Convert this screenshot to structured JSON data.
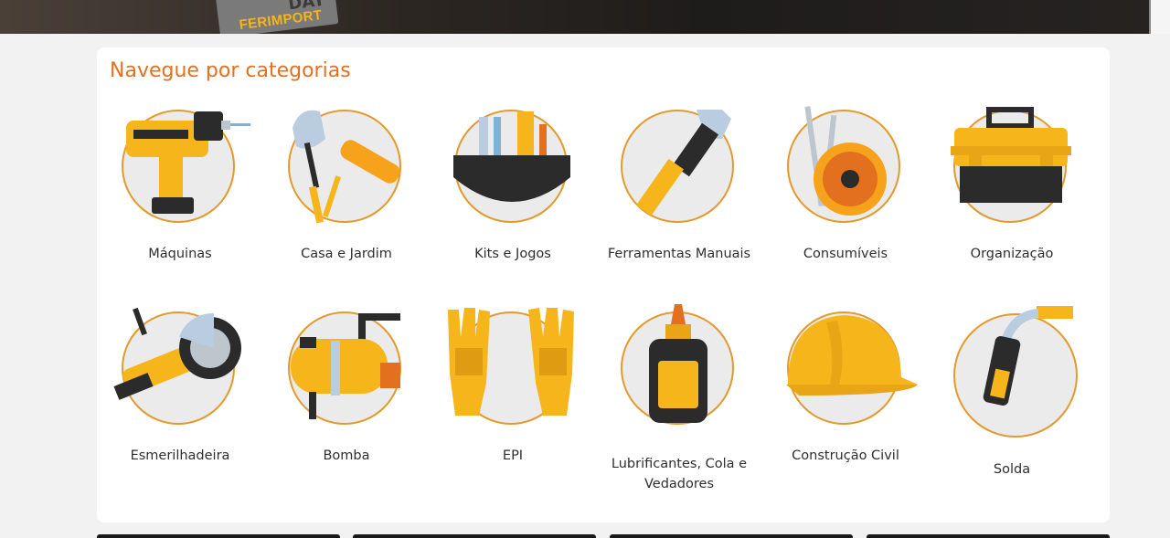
{
  "banner": {
    "logo_word": "DAY",
    "logo_brand": "FERIMPORT"
  },
  "section": {
    "title": "Navegue por categorias"
  },
  "categories": [
    {
      "label": "Máquinas",
      "icon": "drill-icon"
    },
    {
      "label": "Casa e Jardim",
      "icon": "shovel-roller-icon"
    },
    {
      "label": "Kits e Jogos",
      "icon": "tool-kit-icon"
    },
    {
      "label": "Ferramentas Manuais",
      "icon": "wrench-icon"
    },
    {
      "label": "Consumíveis",
      "icon": "drill-bits-disc-icon"
    },
    {
      "label": "Organização",
      "icon": "toolbox-icon"
    },
    {
      "label": "Esmerilhadeira",
      "icon": "angle-grinder-icon"
    },
    {
      "label": "Bomba",
      "icon": "pump-icon"
    },
    {
      "label": "EPI",
      "icon": "gloves-icon"
    },
    {
      "label": "Lubrificantes, Cola e Vedadores",
      "icon": "glue-bottle-icon"
    },
    {
      "label": "Construção Civil",
      "icon": "hard-hat-icon"
    },
    {
      "label": "Solda",
      "icon": "welding-torch-icon"
    }
  ],
  "colors": {
    "accent": "#e3701e",
    "icon_yellow": "#f6b51a",
    "icon_dark": "#2b2b2b"
  }
}
